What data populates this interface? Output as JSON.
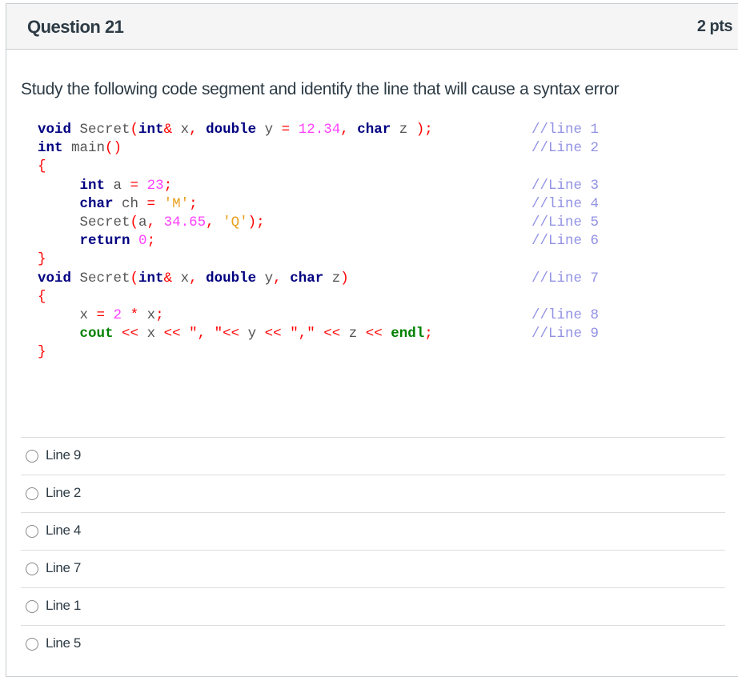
{
  "header": {
    "title": "Question 21",
    "points": "2 pts"
  },
  "question_text": "Study the following code segment and identify the line that will cause a syntax error",
  "code": {
    "lines": [
      {
        "tokens": [
          [
            "kw",
            "void"
          ],
          [
            "fn",
            " Secret"
          ],
          [
            "pn",
            "("
          ],
          [
            "kw",
            "int"
          ],
          [
            "pn",
            "&"
          ],
          [
            "fn",
            " x"
          ],
          [
            "pn",
            ","
          ],
          [
            "fn",
            " "
          ],
          [
            "kw",
            "double"
          ],
          [
            "fn",
            " y "
          ],
          [
            "pn",
            "="
          ],
          [
            "fn",
            " "
          ],
          [
            "num",
            "12.34"
          ],
          [
            "pn",
            ","
          ],
          [
            "fn",
            " "
          ],
          [
            "kw",
            "char"
          ],
          [
            "fn",
            " z "
          ],
          [
            "pn",
            ")"
          ],
          [
            "pn",
            ";"
          ]
        ],
        "comment": "//line 1"
      },
      {
        "tokens": [
          [
            "kw",
            "int"
          ],
          [
            "fn",
            " main"
          ],
          [
            "pn",
            "()"
          ]
        ],
        "comment": "//Line 2"
      },
      {
        "tokens": [
          [
            "pn",
            "{"
          ]
        ],
        "comment": ""
      },
      {
        "tokens": [
          [
            "fn",
            "     "
          ],
          [
            "kw",
            "int"
          ],
          [
            "fn",
            " a "
          ],
          [
            "pn",
            "="
          ],
          [
            "fn",
            " "
          ],
          [
            "num",
            "23"
          ],
          [
            "pn",
            ";"
          ]
        ],
        "comment": "//Line 3"
      },
      {
        "tokens": [
          [
            "fn",
            "     "
          ],
          [
            "kw",
            "char"
          ],
          [
            "fn",
            " ch "
          ],
          [
            "pn",
            "="
          ],
          [
            "fn",
            " "
          ],
          [
            "str",
            "'M'"
          ],
          [
            "pn",
            ";"
          ]
        ],
        "comment": "//line 4"
      },
      {
        "tokens": [
          [
            "fn",
            "     Secret"
          ],
          [
            "pn",
            "("
          ],
          [
            "fn",
            "a"
          ],
          [
            "pn",
            ","
          ],
          [
            "fn",
            " "
          ],
          [
            "num",
            "34.65"
          ],
          [
            "pn",
            ","
          ],
          [
            "fn",
            " "
          ],
          [
            "str",
            "'Q'"
          ],
          [
            "pn",
            ")"
          ],
          [
            "pn",
            ";"
          ]
        ],
        "comment": "//Line 5"
      },
      {
        "tokens": [
          [
            "fn",
            "     "
          ],
          [
            "kw",
            "return"
          ],
          [
            "fn",
            " "
          ],
          [
            "num",
            "0"
          ],
          [
            "pn",
            ";"
          ]
        ],
        "comment": "//Line 6"
      },
      {
        "tokens": [
          [
            "pn",
            "}"
          ]
        ],
        "comment": ""
      },
      {
        "tokens": [
          [
            "kw",
            "void"
          ],
          [
            "fn",
            " Secret"
          ],
          [
            "pn",
            "("
          ],
          [
            "kw",
            "int"
          ],
          [
            "pn",
            "&"
          ],
          [
            "fn",
            " x"
          ],
          [
            "pn",
            ","
          ],
          [
            "fn",
            " "
          ],
          [
            "kw",
            "double"
          ],
          [
            "fn",
            " y"
          ],
          [
            "pn",
            ","
          ],
          [
            "fn",
            " "
          ],
          [
            "kw",
            "char"
          ],
          [
            "fn",
            " z"
          ],
          [
            "pn",
            ")"
          ]
        ],
        "comment": "//Line 7"
      },
      {
        "tokens": [
          [
            "pn",
            "{"
          ]
        ],
        "comment": ""
      },
      {
        "tokens": [
          [
            "fn",
            "     x "
          ],
          [
            "pn",
            "="
          ],
          [
            "fn",
            " "
          ],
          [
            "num",
            "2"
          ],
          [
            "fn",
            " "
          ],
          [
            "pn",
            "*"
          ],
          [
            "fn",
            " x"
          ],
          [
            "pn",
            ";"
          ]
        ],
        "comment": "//line 8"
      },
      {
        "tokens": [
          [
            "fn",
            "     "
          ],
          [
            "kg",
            "cout"
          ],
          [
            "fn",
            " "
          ],
          [
            "pn",
            "<<"
          ],
          [
            "fn",
            " x "
          ],
          [
            "pn",
            "<<"
          ],
          [
            "fn",
            " "
          ],
          [
            "pn",
            "\", \""
          ],
          [
            "pn",
            "<<"
          ],
          [
            "fn",
            " y "
          ],
          [
            "pn",
            "<<"
          ],
          [
            "fn",
            " "
          ],
          [
            "pn",
            "\",\""
          ],
          [
            "fn",
            " "
          ],
          [
            "pn",
            "<<"
          ],
          [
            "fn",
            " z "
          ],
          [
            "pn",
            "<<"
          ],
          [
            "fn",
            " "
          ],
          [
            "kg",
            "endl"
          ],
          [
            "pn",
            ";"
          ]
        ],
        "comment": "//Line 9"
      },
      {
        "tokens": [
          [
            "pn",
            "}"
          ]
        ],
        "comment": ""
      }
    ]
  },
  "answers": [
    {
      "label": "Line 9",
      "selected": false
    },
    {
      "label": "Line 2",
      "selected": false
    },
    {
      "label": "Line 4",
      "selected": false
    },
    {
      "label": "Line 7",
      "selected": false
    },
    {
      "label": "Line 1",
      "selected": false
    },
    {
      "label": "Line 5",
      "selected": false
    }
  ]
}
